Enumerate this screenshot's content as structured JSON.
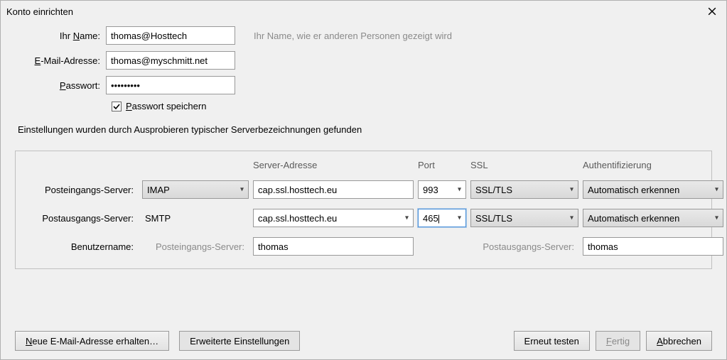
{
  "window": {
    "title": "Konto einrichten"
  },
  "labels": {
    "name_pre": "Ihr ",
    "name_u": "N",
    "name_post": "ame:",
    "email_u": "E",
    "email_post": "-Mail-Adresse:",
    "pass_u": "P",
    "pass_post": "asswort:",
    "save_pw_u": "P",
    "save_pw_post": "asswort speichern",
    "hint": "Ihr Name, wie er anderen Personen gezeigt wird"
  },
  "fields": {
    "name": "thomas@Hosttech",
    "email": "thomas@myschmitt.net",
    "password": "•••••••••",
    "save_password_checked": true
  },
  "status": "Einstellungen wurden durch Ausprobieren typischer Serverbezeichnungen gefunden",
  "server": {
    "headers": {
      "address": "Server-Adresse",
      "port": "Port",
      "ssl": "SSL",
      "auth": "Authentifizierung"
    },
    "row_in_label": "Posteingangs-Server:",
    "row_out_label": "Postausgangs-Server:",
    "row_user_label": "Benutzername:",
    "row_user_in_label": "Posteingangs-Server:",
    "row_user_out_label": "Postausgangs-Server:",
    "incoming": {
      "protocol": "IMAP",
      "host": "cap.ssl.hosttech.eu",
      "port": "993",
      "ssl": "SSL/TLS",
      "auth": "Automatisch erkennen"
    },
    "outgoing": {
      "protocol": "SMTP",
      "host": "cap.ssl.hosttech.eu",
      "port": "465",
      "ssl": "SSL/TLS",
      "auth": "Automatisch erkennen"
    },
    "username_in": "thomas",
    "username_out": "thomas"
  },
  "buttons": {
    "new_email_u": "N",
    "new_email_post": "eue E-Mail-Adresse erhalten…",
    "advanced": "Erweiterte Einstellungen",
    "retest": "Erneut testen",
    "done_u": "F",
    "done_post": "ertig",
    "cancel_u": "A",
    "cancel_post": "bbrechen"
  }
}
